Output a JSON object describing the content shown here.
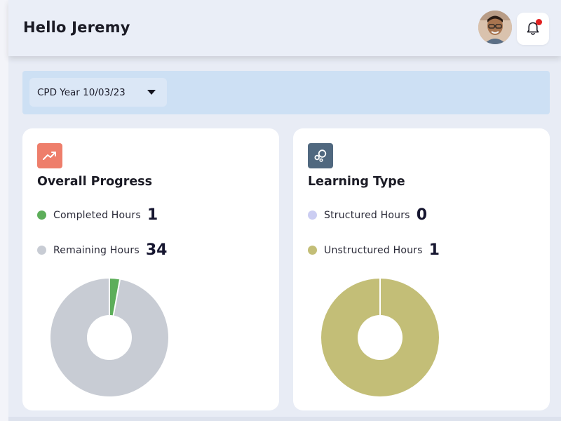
{
  "header": {
    "greeting": "Hello Jeremy",
    "avatar_icon": "user-avatar",
    "bell_icon": "bell-icon",
    "notification_dot_color": "#e02020"
  },
  "filter": {
    "cpd_year_label": "CPD Year 10/03/23",
    "dropdown_icon": "caret-down-icon"
  },
  "overall_progress": {
    "icon": "trending-up-icon",
    "icon_bg": "#ee7e6b",
    "title": "Overall Progress",
    "items": [
      {
        "label": "Completed Hours",
        "value": "1",
        "color": "#5dae5a"
      },
      {
        "label": "Remaining Hours",
        "value": "34",
        "color": "#c8ccd4"
      }
    ]
  },
  "learning_type": {
    "icon": "bubbles-icon",
    "icon_bg": "#50687f",
    "title": "Learning Type",
    "items": [
      {
        "label": "Structured Hours",
        "value": "0",
        "color": "#cbcdf2"
      },
      {
        "label": "Unstructured Hours",
        "value": "1",
        "color": "#c3be77"
      }
    ]
  },
  "chart_data": [
    {
      "type": "pie",
      "categories": [
        "Completed Hours",
        "Remaining Hours"
      ],
      "values": [
        1,
        34
      ],
      "colors": [
        "#5dae5a",
        "#c8ccd4"
      ],
      "title": "Overall Progress"
    },
    {
      "type": "pie",
      "categories": [
        "Structured Hours",
        "Unstructured Hours"
      ],
      "values": [
        0,
        1
      ],
      "colors": [
        "#cbcdf2",
        "#c3be77"
      ],
      "title": "Learning Type"
    }
  ]
}
